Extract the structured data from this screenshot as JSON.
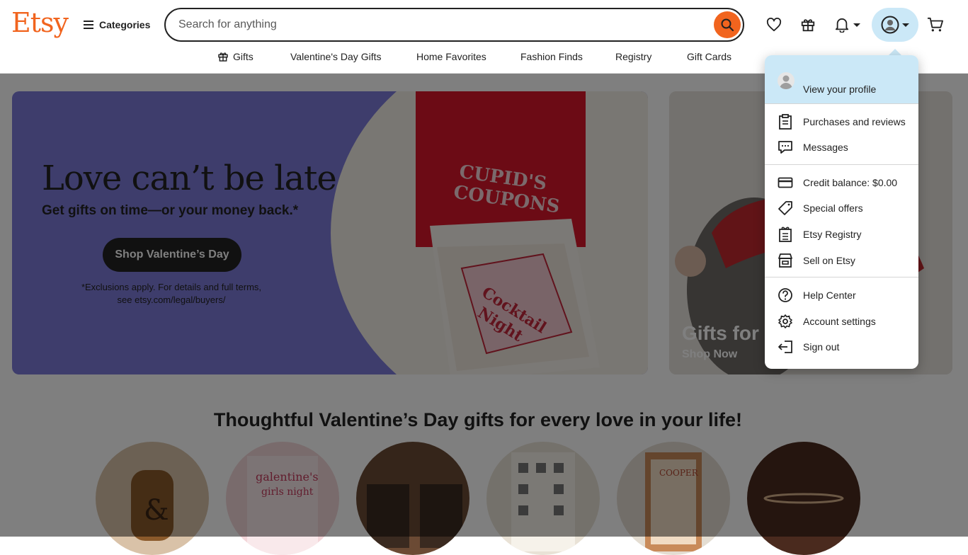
{
  "header": {
    "logo": "Etsy",
    "categories_label": "Categories",
    "search_placeholder": "Search for anything"
  },
  "nav": {
    "items": [
      "Gifts",
      "Valentine's Day Gifts",
      "Home Favorites",
      "Fashion Finds",
      "Registry",
      "Gift Cards"
    ]
  },
  "hero": {
    "title": "Love can’t be late",
    "subtitle": "Get gifts on time—or your money back.*",
    "cta": "Shop Valentine’s Day",
    "fine_print": "*Exclusions apply. For details and full terms, see etsy.com/legal/buyers/"
  },
  "side_card": {
    "title": "Gifts for",
    "link": "Shop Now"
  },
  "section": {
    "title": "Thoughtful Valentine’s Day gifts for every love in your life!"
  },
  "dropdown": {
    "profile_label": "View your profile",
    "items": [
      {
        "label": "Purchases and reviews",
        "icon": "clipboard-icon"
      },
      {
        "label": "Messages",
        "icon": "message-icon"
      },
      {
        "label": "Credit balance: $0.00",
        "icon": "credit-card-icon"
      },
      {
        "label": "Special offers",
        "icon": "tag-icon"
      },
      {
        "label": "Etsy Registry",
        "icon": "registry-icon"
      },
      {
        "label": "Sell on Etsy",
        "icon": "storefront-icon"
      },
      {
        "label": "Help Center",
        "icon": "help-icon"
      },
      {
        "label": "Account settings",
        "icon": "gear-icon"
      },
      {
        "label": "Sign out",
        "icon": "sign-out-icon"
      }
    ]
  },
  "colors": {
    "brand": "#F1641E",
    "profile_highlight": "#cbe8f7",
    "hero_bg": "#7d7ad9"
  }
}
